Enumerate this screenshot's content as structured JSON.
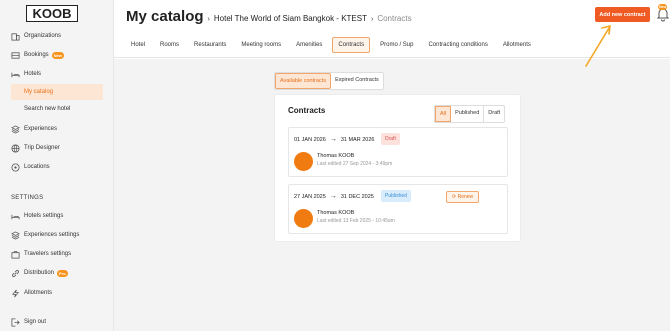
{
  "sidebar": {
    "logo": "KOOB",
    "items": [
      {
        "label": "Organizations",
        "icon": "organizations-icon"
      },
      {
        "label": "Bookings",
        "icon": "bookings-icon",
        "badge": "New"
      },
      {
        "label": "Hotels",
        "icon": "bed-icon"
      },
      {
        "label": "My catalog",
        "active": true
      },
      {
        "label": "Search new hotel"
      },
      {
        "label": "Experiences",
        "icon": "layers-icon"
      },
      {
        "label": "Trip Designer",
        "icon": "globe-icon"
      },
      {
        "label": "Locations",
        "icon": "map-pin-icon"
      }
    ],
    "settings_title": "SETTINGS",
    "settings_items": [
      {
        "label": "Hotels settings",
        "icon": "bed-icon"
      },
      {
        "label": "Experiences settings",
        "icon": "layers-icon"
      },
      {
        "label": "Travelers settings",
        "icon": "briefcase-icon"
      },
      {
        "label": "Distribution",
        "icon": "link-icon",
        "badge": "Pro"
      },
      {
        "label": "Allotments",
        "icon": "bolt-icon"
      }
    ],
    "signout": "Sign out"
  },
  "header": {
    "title": "My catalog",
    "breadcrumb": [
      "Hotel The World of Siam Bangkok - KTEST",
      "Contracts"
    ],
    "add_button": "Add new contract",
    "bell_badge": "New",
    "tabs": [
      {
        "label": "Hotel"
      },
      {
        "label": "Rooms"
      },
      {
        "label": "Restaurants"
      },
      {
        "label": "Meeting rooms"
      },
      {
        "label": "Amenities"
      },
      {
        "label": "Contracts",
        "active": true
      },
      {
        "label": "Promo / Sup"
      },
      {
        "label": "Contracting conditions"
      },
      {
        "label": "Allotments"
      }
    ]
  },
  "main": {
    "toggle": [
      "Available contracts",
      "Expired Contracts"
    ],
    "card": {
      "title": "Contracts",
      "filters": [
        "All",
        "Published",
        "Draft"
      ],
      "contracts": [
        {
          "start": "01 JAN 2026",
          "end": "31 MAR 2026",
          "status": "Draft",
          "author": "Thomas KOOB",
          "edited": "Last edited 27 Sep 2024 - 3:49pm"
        },
        {
          "start": "27 JAN 2025",
          "end": "31 DEC 2025",
          "status": "Published",
          "renew": "Renew",
          "author": "Thomas KOOB",
          "edited": "Last edited 13 Feb 2025 - 10:45am"
        }
      ]
    }
  },
  "colors": {
    "accent": "#ef5b22",
    "active_bg": "#fde6d3",
    "pointer": "#f5a623"
  }
}
